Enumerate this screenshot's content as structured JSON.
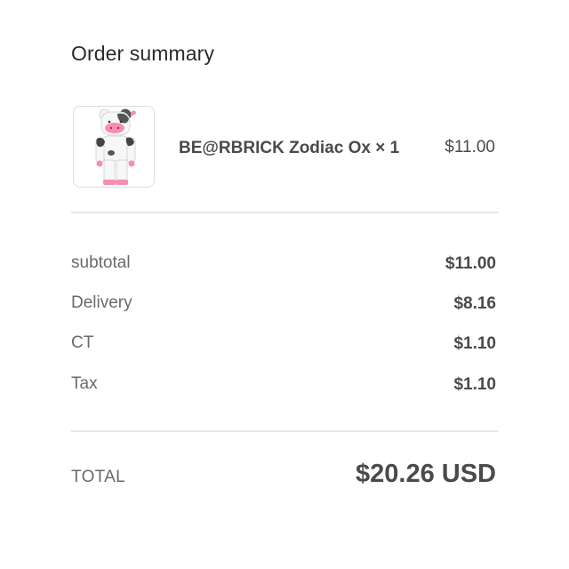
{
  "order_summary": {
    "title": "Order summary",
    "item": {
      "name": "BE@RBRICK Zodiac Ox × 1",
      "price": "$11.00",
      "thumbnail_icon": "bearbrick-ox-figure-icon"
    },
    "lines": [
      {
        "label": "subtotal",
        "value": "$11.00"
      },
      {
        "label": "Delivery",
        "value": "$8.16"
      },
      {
        "label": "CT",
        "value": "$1.10"
      },
      {
        "label": "Tax",
        "value": "$1.10"
      }
    ],
    "total": {
      "label": "TOTAL",
      "value": "$20.26 USD"
    }
  },
  "colors": {
    "text_dark": "#4a4a4a",
    "text_muted": "#6a6a6a",
    "divider": "#e6e6e6",
    "accent_pink": "#f48fb1"
  }
}
